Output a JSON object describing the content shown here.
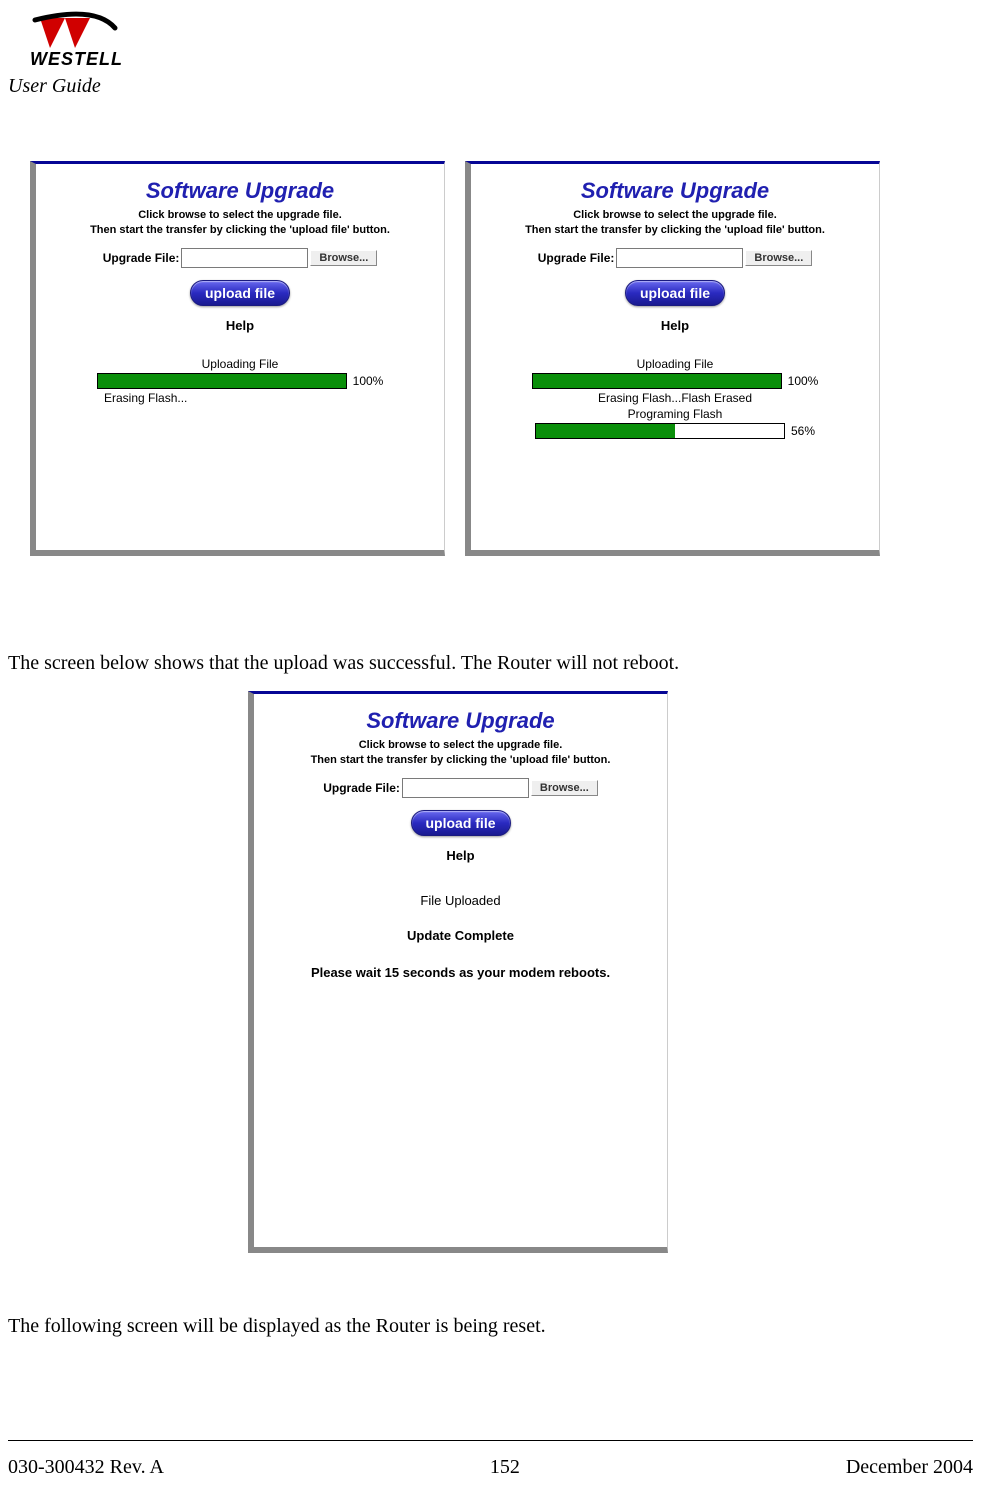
{
  "header": {
    "brand_text": "WESTELL",
    "subtitle": "User Guide"
  },
  "footer": {
    "doc_ref": "030-300432 Rev. A",
    "page_number": "152",
    "date": "December 2004"
  },
  "body": {
    "para_success": "The screen below shows that the upload was successful. The Router will not reboot.",
    "para_reset": "The following screen will be displayed as the Router is being reset."
  },
  "panel_common": {
    "title": "Software Upgrade",
    "instruction_line1": "Click browse to select the upgrade file.",
    "instruction_line2": "Then start the transfer by clicking the 'upload file' button.",
    "upgrade_file_label": "Upgrade File:",
    "browse_label": "Browse...",
    "upload_button_label": "upload file",
    "help_label": "Help"
  },
  "panel1": {
    "progress1_label": "Uploading File",
    "progress1_pct": "100%",
    "progress1_fill_width": "100%",
    "status1": "Erasing Flash..."
  },
  "panel2": {
    "progress1_label": "Uploading File",
    "progress1_pct": "100%",
    "progress1_fill_width": "100%",
    "status1": "Erasing Flash...Flash Erased",
    "progress2_label": "Programing Flash",
    "progress2_pct": "56%",
    "progress2_fill_width": "56%"
  },
  "panel3": {
    "status_uploaded": "File Uploaded",
    "status_complete": "Update Complete",
    "status_wait": "Please wait 15 seconds as your modem reboots."
  }
}
